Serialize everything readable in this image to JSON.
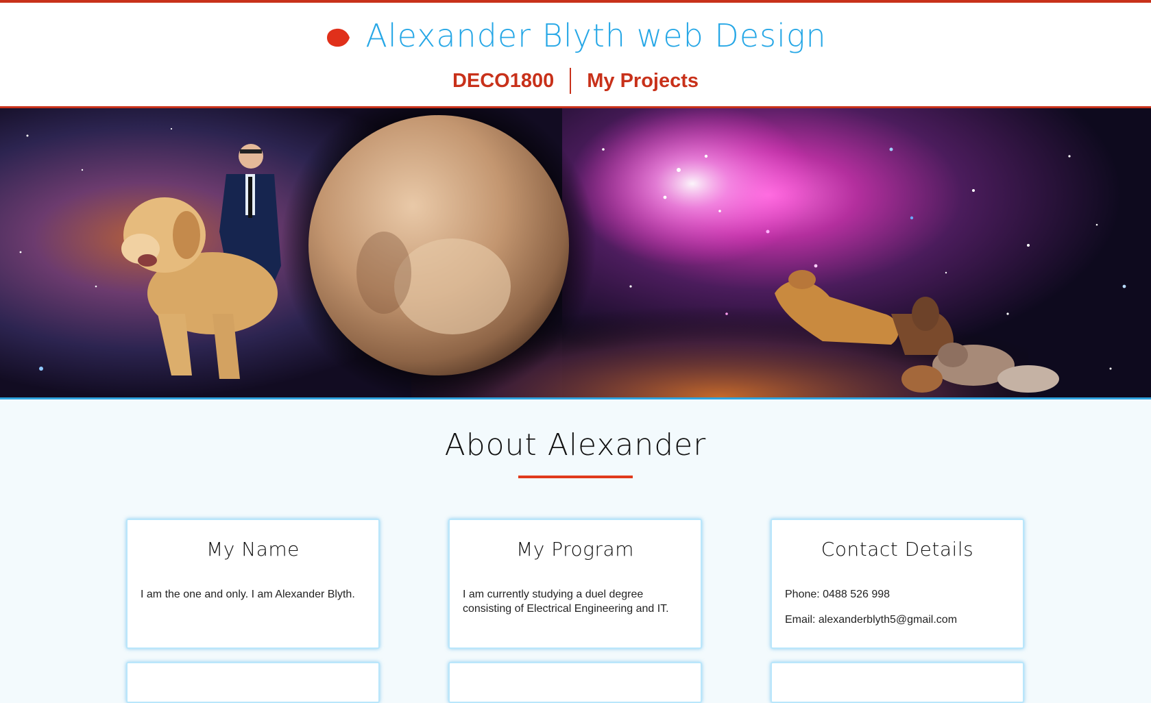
{
  "colors": {
    "accent_red": "#c8311a",
    "brand_blue": "#26a7e6",
    "card_glow": "#b9e6fb",
    "page_background": "#f3fafd"
  },
  "header": {
    "logo_icon": "red-dot-icon",
    "title": "Alexander Blyth web Design",
    "nav": [
      {
        "label": "DECO1800"
      },
      {
        "label": "My Projects"
      }
    ]
  },
  "hero": {
    "image": "space-banner-with-man-riding-golden-retriever-planet-and-dachshunds"
  },
  "about": {
    "heading": "About Alexander",
    "cards": [
      {
        "title": "My Name",
        "lines": [
          "I am the one and only. I am Alexander Blyth."
        ]
      },
      {
        "title": "My Program",
        "lines": [
          "I am currently studying a duel degree consisting of Electrical Engineering and IT."
        ]
      },
      {
        "title": "Contact Details",
        "lines": [
          "Phone: 0488 526 998",
          "Email: alexanderblyth5@gmail.com"
        ]
      }
    ]
  }
}
